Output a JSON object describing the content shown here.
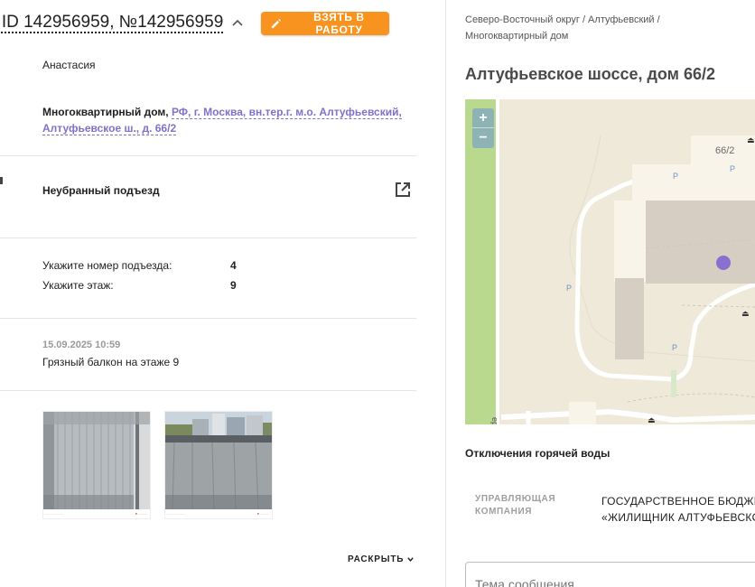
{
  "ticket": {
    "title": "., ID 142956959, №142956959",
    "take_button_label": "ВЗЯТЬ В РАБОТУ",
    "author": "Анастасия",
    "address_type": "Многоквартирный дом,",
    "address_link": "РФ, г. Москва, вн.тер.г. м.о. Алтуфьевский, Алтуфьевское ш., д. 66/2",
    "category": "Неубранный подъезд",
    "questions": [
      {
        "label": "Укажите номер подъезда:",
        "value": "4"
      },
      {
        "label": "Укажите этаж:",
        "value": "9"
      }
    ],
    "comment_date": "15.09.2025 10:59",
    "comment_text": "Грязный балкон на этаже 9",
    "photos": [
      {
        "name": "photo-1"
      },
      {
        "name": "photo-2"
      }
    ],
    "expand_label": "РАСКРЫТЬ"
  },
  "object": {
    "breadcrumb": "Северо-Восточный округ / Алтуфьевский / Многоквартирный дом",
    "address_title": "Алтуфьевское шоссе, дом 66/2",
    "map": {
      "zoom_in": "+",
      "zoom_out": "−",
      "building_label": "66/2",
      "parking_label": "P"
    },
    "hot_water_title": "Отключения горячей воды",
    "management_label": "УПРАВЛЯЮЩАЯ КОМПАНИЯ",
    "management_value_line1": "ГОСУДАРСТВЕННОЕ БЮДЖЕТ",
    "management_value_line2": "«ЖИЛИЩНИК АЛТУФЬЕВСКО",
    "message_placeholder": "Тема сообщения"
  },
  "colors": {
    "accent": "#f7931e",
    "link": "#7f72c8",
    "map_marker": "#8a6fd1"
  },
  "icons": [
    "pencil-icon",
    "chevron-up-icon",
    "open-in-new-icon",
    "chevron-down-icon",
    "zoom-in-icon",
    "zoom-out-icon"
  ]
}
